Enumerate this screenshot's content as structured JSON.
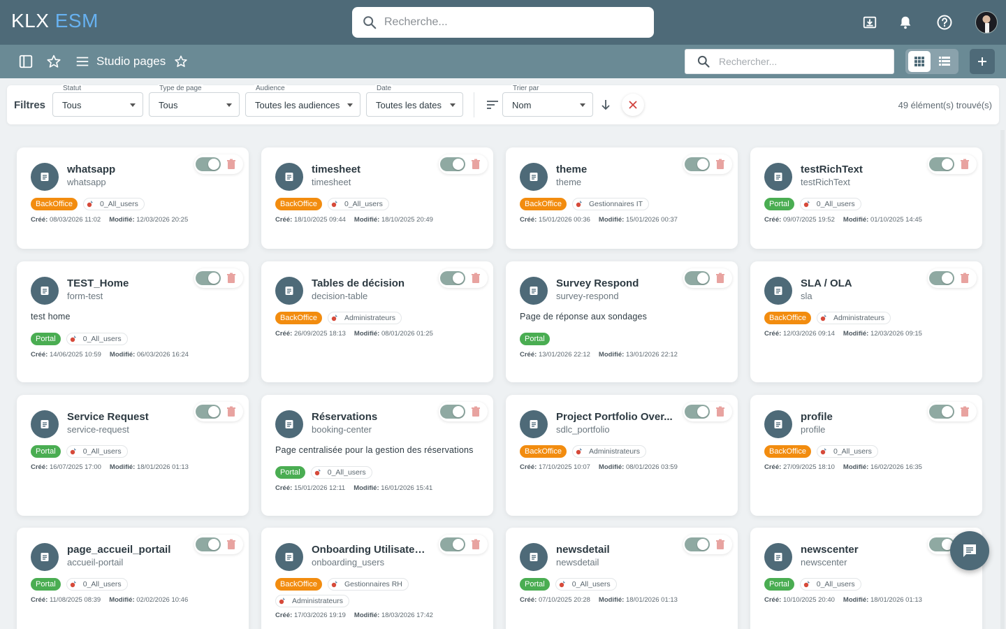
{
  "app": {
    "logo_part1": "KLX",
    "logo_part2": "ESM"
  },
  "topbar": {
    "search_placeholder": "Recherche...",
    "icons": [
      "download-icon",
      "bell-icon",
      "help-icon"
    ],
    "colors": {
      "bar": "#4e6a78",
      "logo_accent": "#67b1f0"
    }
  },
  "subbar": {
    "page_title": "Studio pages",
    "search_placeholder": "Rechercher...",
    "view_mode": "grid"
  },
  "filters": {
    "label": "Filtres",
    "statut": {
      "label": "Statut",
      "value": "Tous"
    },
    "type": {
      "label": "Type de page",
      "value": "Tous"
    },
    "audience": {
      "label": "Audience",
      "value": "Toutes les audiences"
    },
    "date": {
      "label": "Date",
      "value": "Toutes les dates"
    },
    "sort": {
      "label": "Trier par",
      "value": "Nom"
    },
    "count": "49 élément(s) trouvé(s)"
  },
  "labels": {
    "created": "Créé:",
    "modified": "Modifié:"
  },
  "colors": {
    "backoffice": "#f28c0f",
    "portal": "#4aad52",
    "toggle_on": "#8fa9a2"
  },
  "cards": [
    {
      "title": "whatsapp",
      "slug": "whatsapp",
      "desc": "",
      "tags": [
        {
          "type": "backoffice",
          "label": "BackOffice"
        }
      ],
      "audiences": [
        "0_All_users"
      ],
      "created": "08/03/2026 11:02",
      "modified": "12/03/2026 20:25",
      "active": true
    },
    {
      "title": "timesheet",
      "slug": "timesheet",
      "desc": "",
      "tags": [
        {
          "type": "backoffice",
          "label": "BackOffice"
        }
      ],
      "audiences": [
        "0_All_users"
      ],
      "created": "18/10/2025 09:44",
      "modified": "18/10/2025 20:49",
      "active": true
    },
    {
      "title": "theme",
      "slug": "theme",
      "desc": "",
      "tags": [
        {
          "type": "backoffice",
          "label": "BackOffice"
        }
      ],
      "audiences": [
        "Gestionnaires IT"
      ],
      "created": "15/01/2026 00:36",
      "modified": "15/01/2026 00:37",
      "active": true
    },
    {
      "title": "testRichText",
      "slug": "testRichText",
      "desc": "",
      "tags": [
        {
          "type": "portal",
          "label": "Portal"
        }
      ],
      "audiences": [
        "0_All_users"
      ],
      "created": "09/07/2025 19:52",
      "modified": "01/10/2025 14:45",
      "active": true
    },
    {
      "title": "TEST_Home",
      "slug": "form-test",
      "desc": "test home",
      "tags": [
        {
          "type": "portal",
          "label": "Portal"
        }
      ],
      "audiences": [
        "0_All_users"
      ],
      "created": "14/06/2025 10:59",
      "modified": "06/03/2026 16:24",
      "active": true
    },
    {
      "title": "Tables de décision",
      "slug": "decision-table",
      "desc": "",
      "tags": [
        {
          "type": "backoffice",
          "label": "BackOffice"
        }
      ],
      "audiences": [
        "Administrateurs"
      ],
      "created": "26/09/2025 18:13",
      "modified": "08/01/2026 01:25",
      "active": true
    },
    {
      "title": "Survey Respond",
      "slug": "survey-respond",
      "desc": "Page de réponse aux sondages",
      "tags": [
        {
          "type": "portal",
          "label": "Portal"
        }
      ],
      "audiences": [],
      "created": "13/01/2026 22:12",
      "modified": "13/01/2026 22:12",
      "active": true
    },
    {
      "title": "SLA / OLA",
      "slug": "sla",
      "desc": "",
      "tags": [
        {
          "type": "backoffice",
          "label": "BackOffice"
        }
      ],
      "audiences": [
        "Administrateurs"
      ],
      "created": "12/03/2026 09:14",
      "modified": "12/03/2026 09:15",
      "active": true
    },
    {
      "title": "Service Request",
      "slug": "service-request",
      "desc": "",
      "tags": [
        {
          "type": "portal",
          "label": "Portal"
        }
      ],
      "audiences": [
        "0_All_users"
      ],
      "created": "16/07/2025 17:00",
      "modified": "18/01/2026 01:13",
      "active": true
    },
    {
      "title": "Réservations",
      "slug": "booking-center",
      "desc": "Page centralisée pour la gestion des réservations",
      "tags": [
        {
          "type": "portal",
          "label": "Portal"
        }
      ],
      "audiences": [
        "0_All_users"
      ],
      "created": "15/01/2026 12:11",
      "modified": "16/01/2026 15:41",
      "active": true
    },
    {
      "title": "Project Portfolio Over...",
      "slug": "sdlc_portfolio",
      "desc": "",
      "tags": [
        {
          "type": "backoffice",
          "label": "BackOffice"
        }
      ],
      "audiences": [
        "Administrateurs"
      ],
      "created": "17/10/2025 10:07",
      "modified": "08/01/2026 03:59",
      "active": true
    },
    {
      "title": "profile",
      "slug": "profile",
      "desc": "",
      "tags": [
        {
          "type": "backoffice",
          "label": "BackOffice"
        }
      ],
      "audiences": [
        "0_All_users"
      ],
      "created": "27/09/2025 18:10",
      "modified": "16/02/2026 16:35",
      "active": true
    },
    {
      "title": "page_accueil_portail",
      "slug": "accueil-portail",
      "desc": "",
      "tags": [
        {
          "type": "portal",
          "label": "Portal"
        }
      ],
      "audiences": [
        "0_All_users"
      ],
      "created": "11/08/2025 08:39",
      "modified": "02/02/2026 10:46",
      "active": true
    },
    {
      "title": "Onboarding Utilisateurs",
      "slug": "onboarding_users",
      "desc": "",
      "tags": [
        {
          "type": "backoffice",
          "label": "BackOffice"
        }
      ],
      "audiences": [
        "Gestionnaires RH",
        "Administrateurs"
      ],
      "created": "17/03/2026 19:19",
      "modified": "18/03/2026 17:42",
      "active": true
    },
    {
      "title": "newsdetail",
      "slug": "newsdetail",
      "desc": "",
      "tags": [
        {
          "type": "portal",
          "label": "Portal"
        }
      ],
      "audiences": [
        "0_All_users"
      ],
      "created": "07/10/2025 20:28",
      "modified": "18/01/2026 01:13",
      "active": true
    },
    {
      "title": "newscenter",
      "slug": "newscenter",
      "desc": "",
      "tags": [
        {
          "type": "portal",
          "label": "Portal"
        }
      ],
      "audiences": [
        "0_All_users"
      ],
      "created": "10/10/2025 20:40",
      "modified": "18/01/2026 01:13",
      "active": true
    }
  ]
}
